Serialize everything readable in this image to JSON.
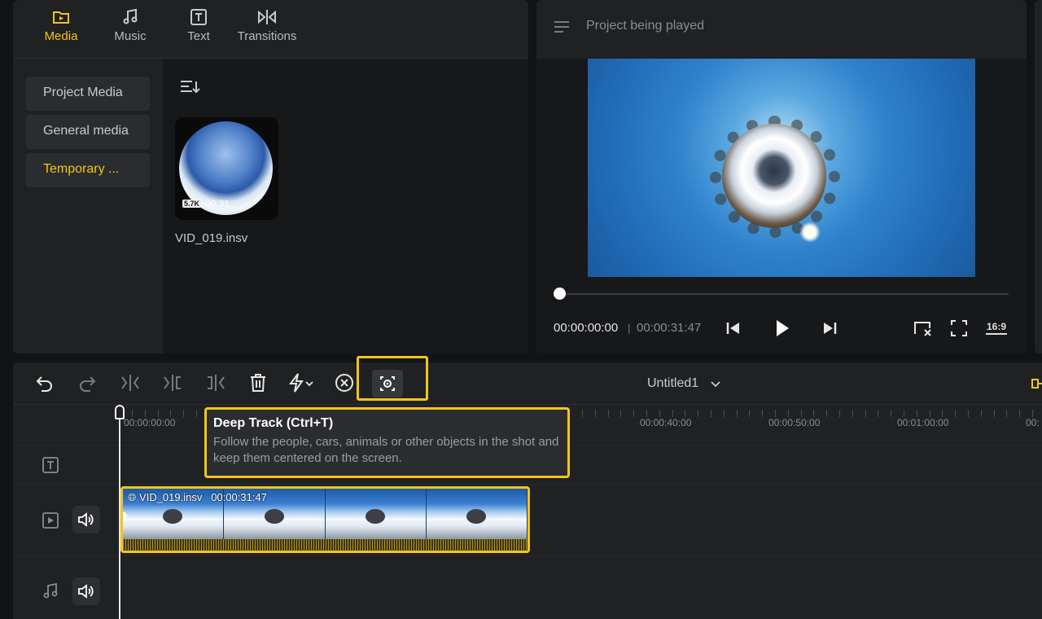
{
  "media_panel": {
    "tabs": [
      {
        "label": "Media",
        "icon": "folder-play-icon",
        "active": true
      },
      {
        "label": "Music",
        "icon": "music-note-icon",
        "active": false
      },
      {
        "label": "Text",
        "icon": "text-box-icon",
        "active": false
      },
      {
        "label": "Transitions",
        "icon": "transition-icon",
        "active": false
      }
    ],
    "sidebar": [
      {
        "label": "Project Media"
      },
      {
        "label": "General media"
      },
      {
        "label": "Temporary ..."
      }
    ],
    "sort_icon": "sort-list-icon",
    "items": [
      {
        "name": "VID_019.insv",
        "resolution": "5.7K",
        "duration": "00:31"
      }
    ]
  },
  "player": {
    "title": "Project being played",
    "current_time": "00:00:00:00",
    "separator": "|",
    "total_time": "00:00:31:47",
    "progress": 0,
    "aspect_ratio": "16:9"
  },
  "timeline": {
    "project_title": "Untitled1",
    "ruler_labels": [
      "00:00:00:00",
      "00:00:40:00",
      "00:00:50:00",
      "00:01:00:00",
      "00:"
    ],
    "clip": {
      "label": "VID_019.insv",
      "duration": "00:00:31:47"
    },
    "tooltip": {
      "title": "Deep Track (Ctrl+T)",
      "body": "Follow the people, cars, animals or other objects in the shot and keep them centered on the screen."
    }
  },
  "colors": {
    "accent": "#f5c518",
    "panel_bg": "#1f2123",
    "app_bg": "#121314"
  }
}
